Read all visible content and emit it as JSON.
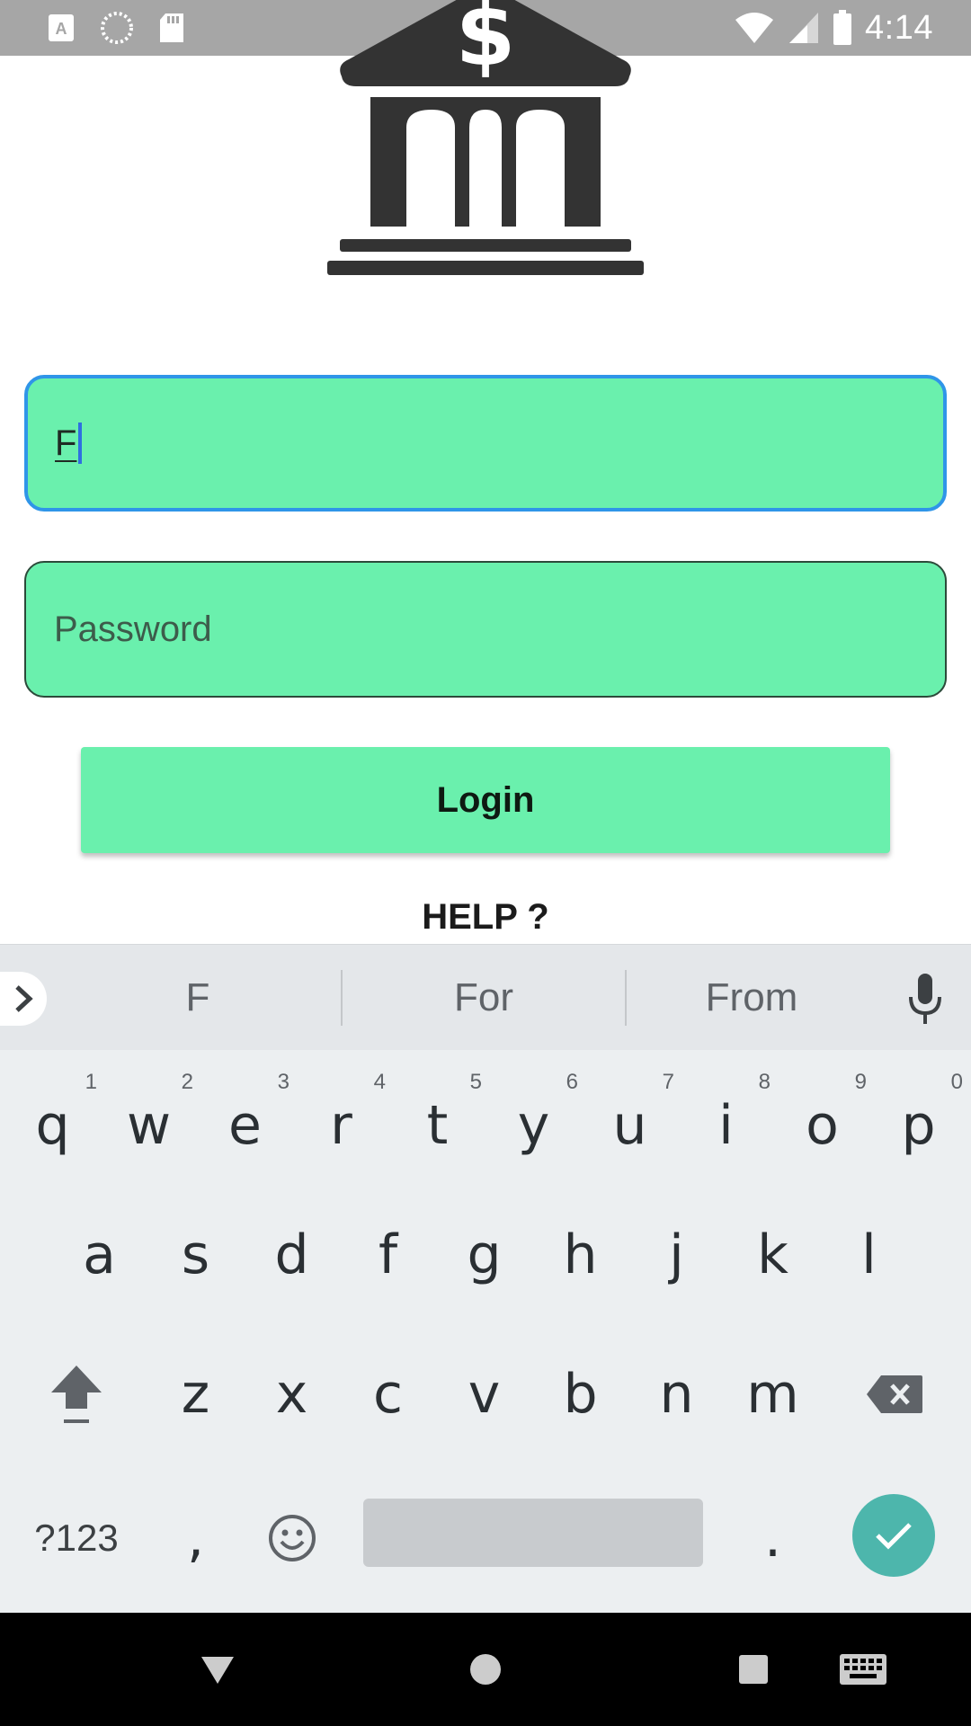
{
  "status_bar": {
    "time": "4:14",
    "left_icons": [
      "text-notification-icon",
      "sync-icon",
      "sd-card-icon"
    ],
    "right_icons": [
      "wifi-icon",
      "cell-signal-icon",
      "battery-icon"
    ]
  },
  "login_form": {
    "username": {
      "value": "F"
    },
    "password": {
      "placeholder": "Password"
    },
    "login_label": "Login",
    "help_label": "HELP ?"
  },
  "keyboard": {
    "suggestions": [
      "F",
      "For",
      "From"
    ],
    "row1": [
      {
        "k": "q",
        "h": "1"
      },
      {
        "k": "w",
        "h": "2"
      },
      {
        "k": "e",
        "h": "3"
      },
      {
        "k": "r",
        "h": "4"
      },
      {
        "k": "t",
        "h": "5"
      },
      {
        "k": "y",
        "h": "6"
      },
      {
        "k": "u",
        "h": "7"
      },
      {
        "k": "i",
        "h": "8"
      },
      {
        "k": "o",
        "h": "9"
      },
      {
        "k": "p",
        "h": "0"
      }
    ],
    "row2": [
      "a",
      "s",
      "d",
      "f",
      "g",
      "h",
      "j",
      "k",
      "l"
    ],
    "row3": [
      "z",
      "x",
      "c",
      "v",
      "b",
      "n",
      "m"
    ],
    "symbols_label": "?123",
    "comma_label": ",",
    "period_label": "."
  },
  "colors": {
    "field_fill": "#6af0ad",
    "focus_border": "#2f95e8",
    "enter_key": "#4db6ac"
  }
}
